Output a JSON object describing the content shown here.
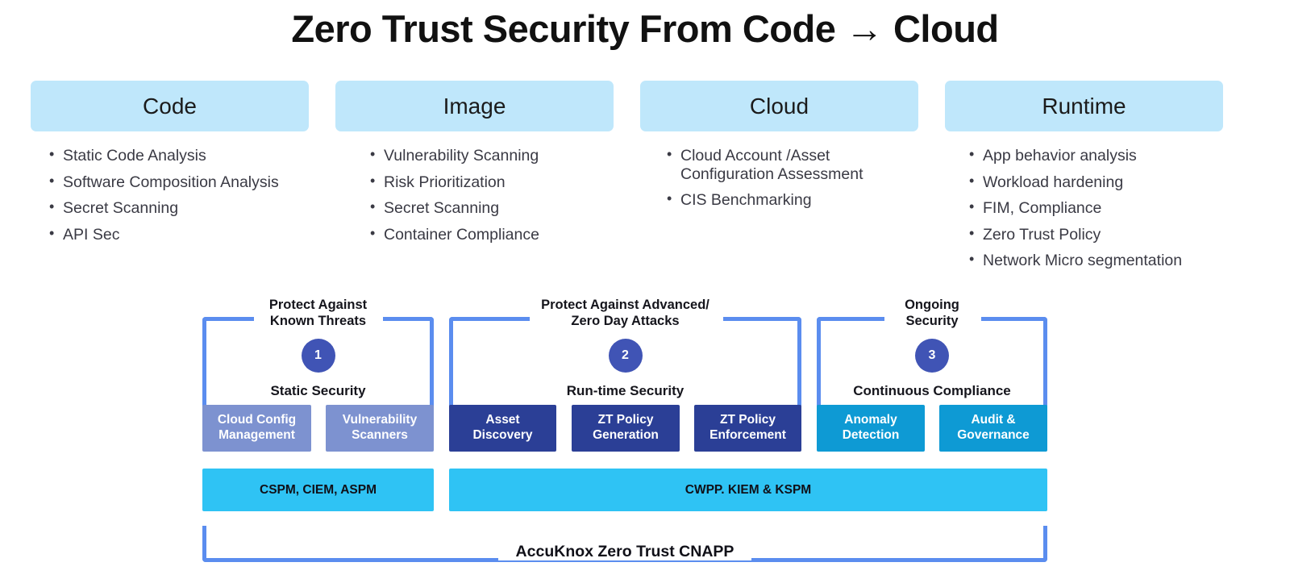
{
  "title": {
    "before": "Zero Trust Security From Code ",
    "arrow": "→",
    "after": " Cloud"
  },
  "colors": {
    "header_bg": "#bfe7fb",
    "bracket": "#5b8def",
    "circle": "#4054b5",
    "periwinkle": "#7d92d0",
    "navy": "#2b3f96",
    "cyan": "#0e9ad4",
    "bar": "#2fc3f4"
  },
  "columns": [
    {
      "header": "Code",
      "items": [
        "Static Code Analysis",
        "Software Composition Analysis",
        "Secret Scanning",
        "API Sec"
      ]
    },
    {
      "header": "Image",
      "items": [
        "Vulnerability Scanning",
        "Risk Prioritization",
        "Secret Scanning",
        "Container Compliance"
      ]
    },
    {
      "header": "Cloud",
      "items": [
        "Cloud Account /Asset Configuration Assessment",
        "CIS Benchmarking"
      ]
    },
    {
      "header": "Runtime",
      "items": [
        "App behavior analysis",
        "Workload hardening",
        "FIM, Compliance",
        "Zero Trust Policy",
        "Network Micro segmentation"
      ]
    }
  ],
  "stages": [
    {
      "top_label": "Protect Against\nKnown Threats",
      "number": "1",
      "bottom_label": "Static Security"
    },
    {
      "top_label": "Protect Against Advanced/\nZero Day Attacks",
      "number": "2",
      "bottom_label": "Run-time Security"
    },
    {
      "top_label": "Ongoing\nSecurity",
      "number": "3",
      "bottom_label": "Continuous Compliance"
    }
  ],
  "capabilities": [
    {
      "label": "Cloud Config\nManagement",
      "tone": "periwinkle"
    },
    {
      "label": "Vulnerability\nScanners",
      "tone": "periwinkle"
    },
    {
      "label": "Asset\nDiscovery",
      "tone": "navy"
    },
    {
      "label": "ZT Policy\nGeneration",
      "tone": "navy"
    },
    {
      "label": "ZT Policy\nEnforcement",
      "tone": "navy"
    },
    {
      "label": "Anomaly\nDetection",
      "tone": "cyan"
    },
    {
      "label": "Audit &\nGovernance",
      "tone": "cyan"
    }
  ],
  "platform_bars": [
    "CSPM, CIEM, ASPM",
    "CWPP. KIEM & KSPM"
  ],
  "footer_label": "AccuKnox Zero Trust CNAPP"
}
